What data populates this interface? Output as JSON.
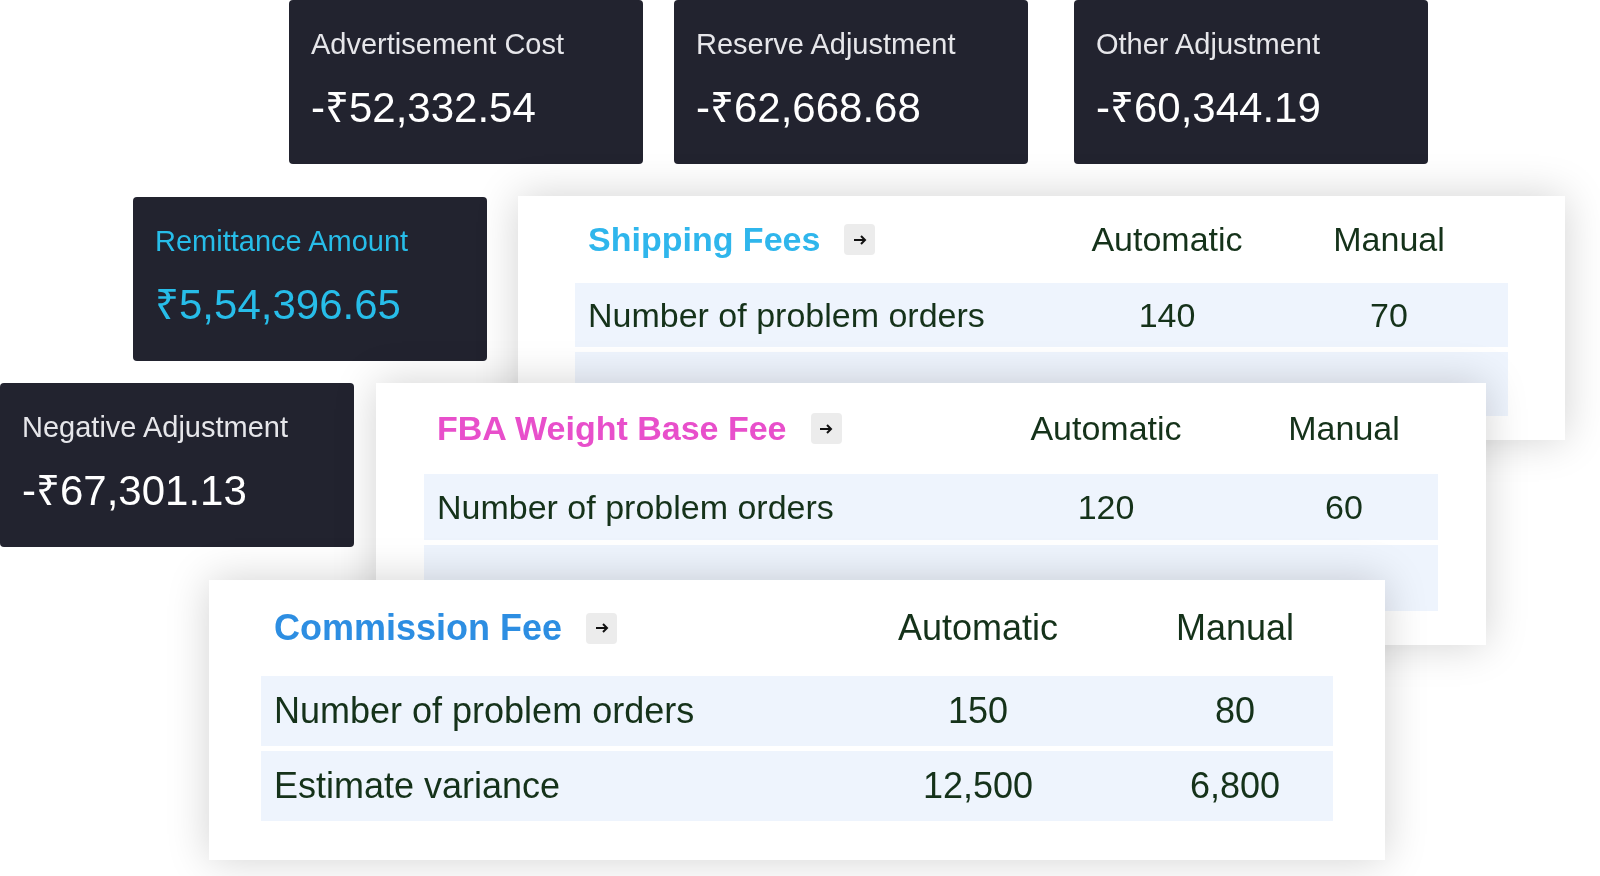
{
  "summary_cards": [
    {
      "label": "Advertisement Cost",
      "value": "-₹52,332.54",
      "highlighted": false
    },
    {
      "label": "Reserve Adjustment",
      "value": "-₹62,668.68",
      "highlighted": false
    },
    {
      "label": "Other Adjustment",
      "value": "-₹60,344.19",
      "highlighted": false
    },
    {
      "label": "Remittance Amount",
      "value": "₹5,54,396.65",
      "highlighted": true
    },
    {
      "label": "Negative Adjustment",
      "value": "-₹67,301.13",
      "highlighted": false
    }
  ],
  "fee_tables": [
    {
      "title": "Shipping Fees",
      "color": "#2fb6ec",
      "columns": [
        "Automatic",
        "Manual"
      ],
      "rows": [
        {
          "label": "Number of problem orders",
          "automatic": "140",
          "manual": "70"
        }
      ]
    },
    {
      "title": "FBA Weight Base Fee",
      "color": "#e84fcb",
      "columns": [
        "Automatic",
        "Manual"
      ],
      "rows": [
        {
          "label": "Number of problem orders",
          "automatic": "120",
          "manual": "60"
        }
      ]
    },
    {
      "title": "Commission Fee",
      "color": "#2d8ee2",
      "columns": [
        "Automatic",
        "Manual"
      ],
      "rows": [
        {
          "label": "Number of problem orders",
          "automatic": "150",
          "manual": "80"
        },
        {
          "label": "Estimate variance",
          "automatic": "12,500",
          "manual": "6,800"
        }
      ]
    }
  ]
}
